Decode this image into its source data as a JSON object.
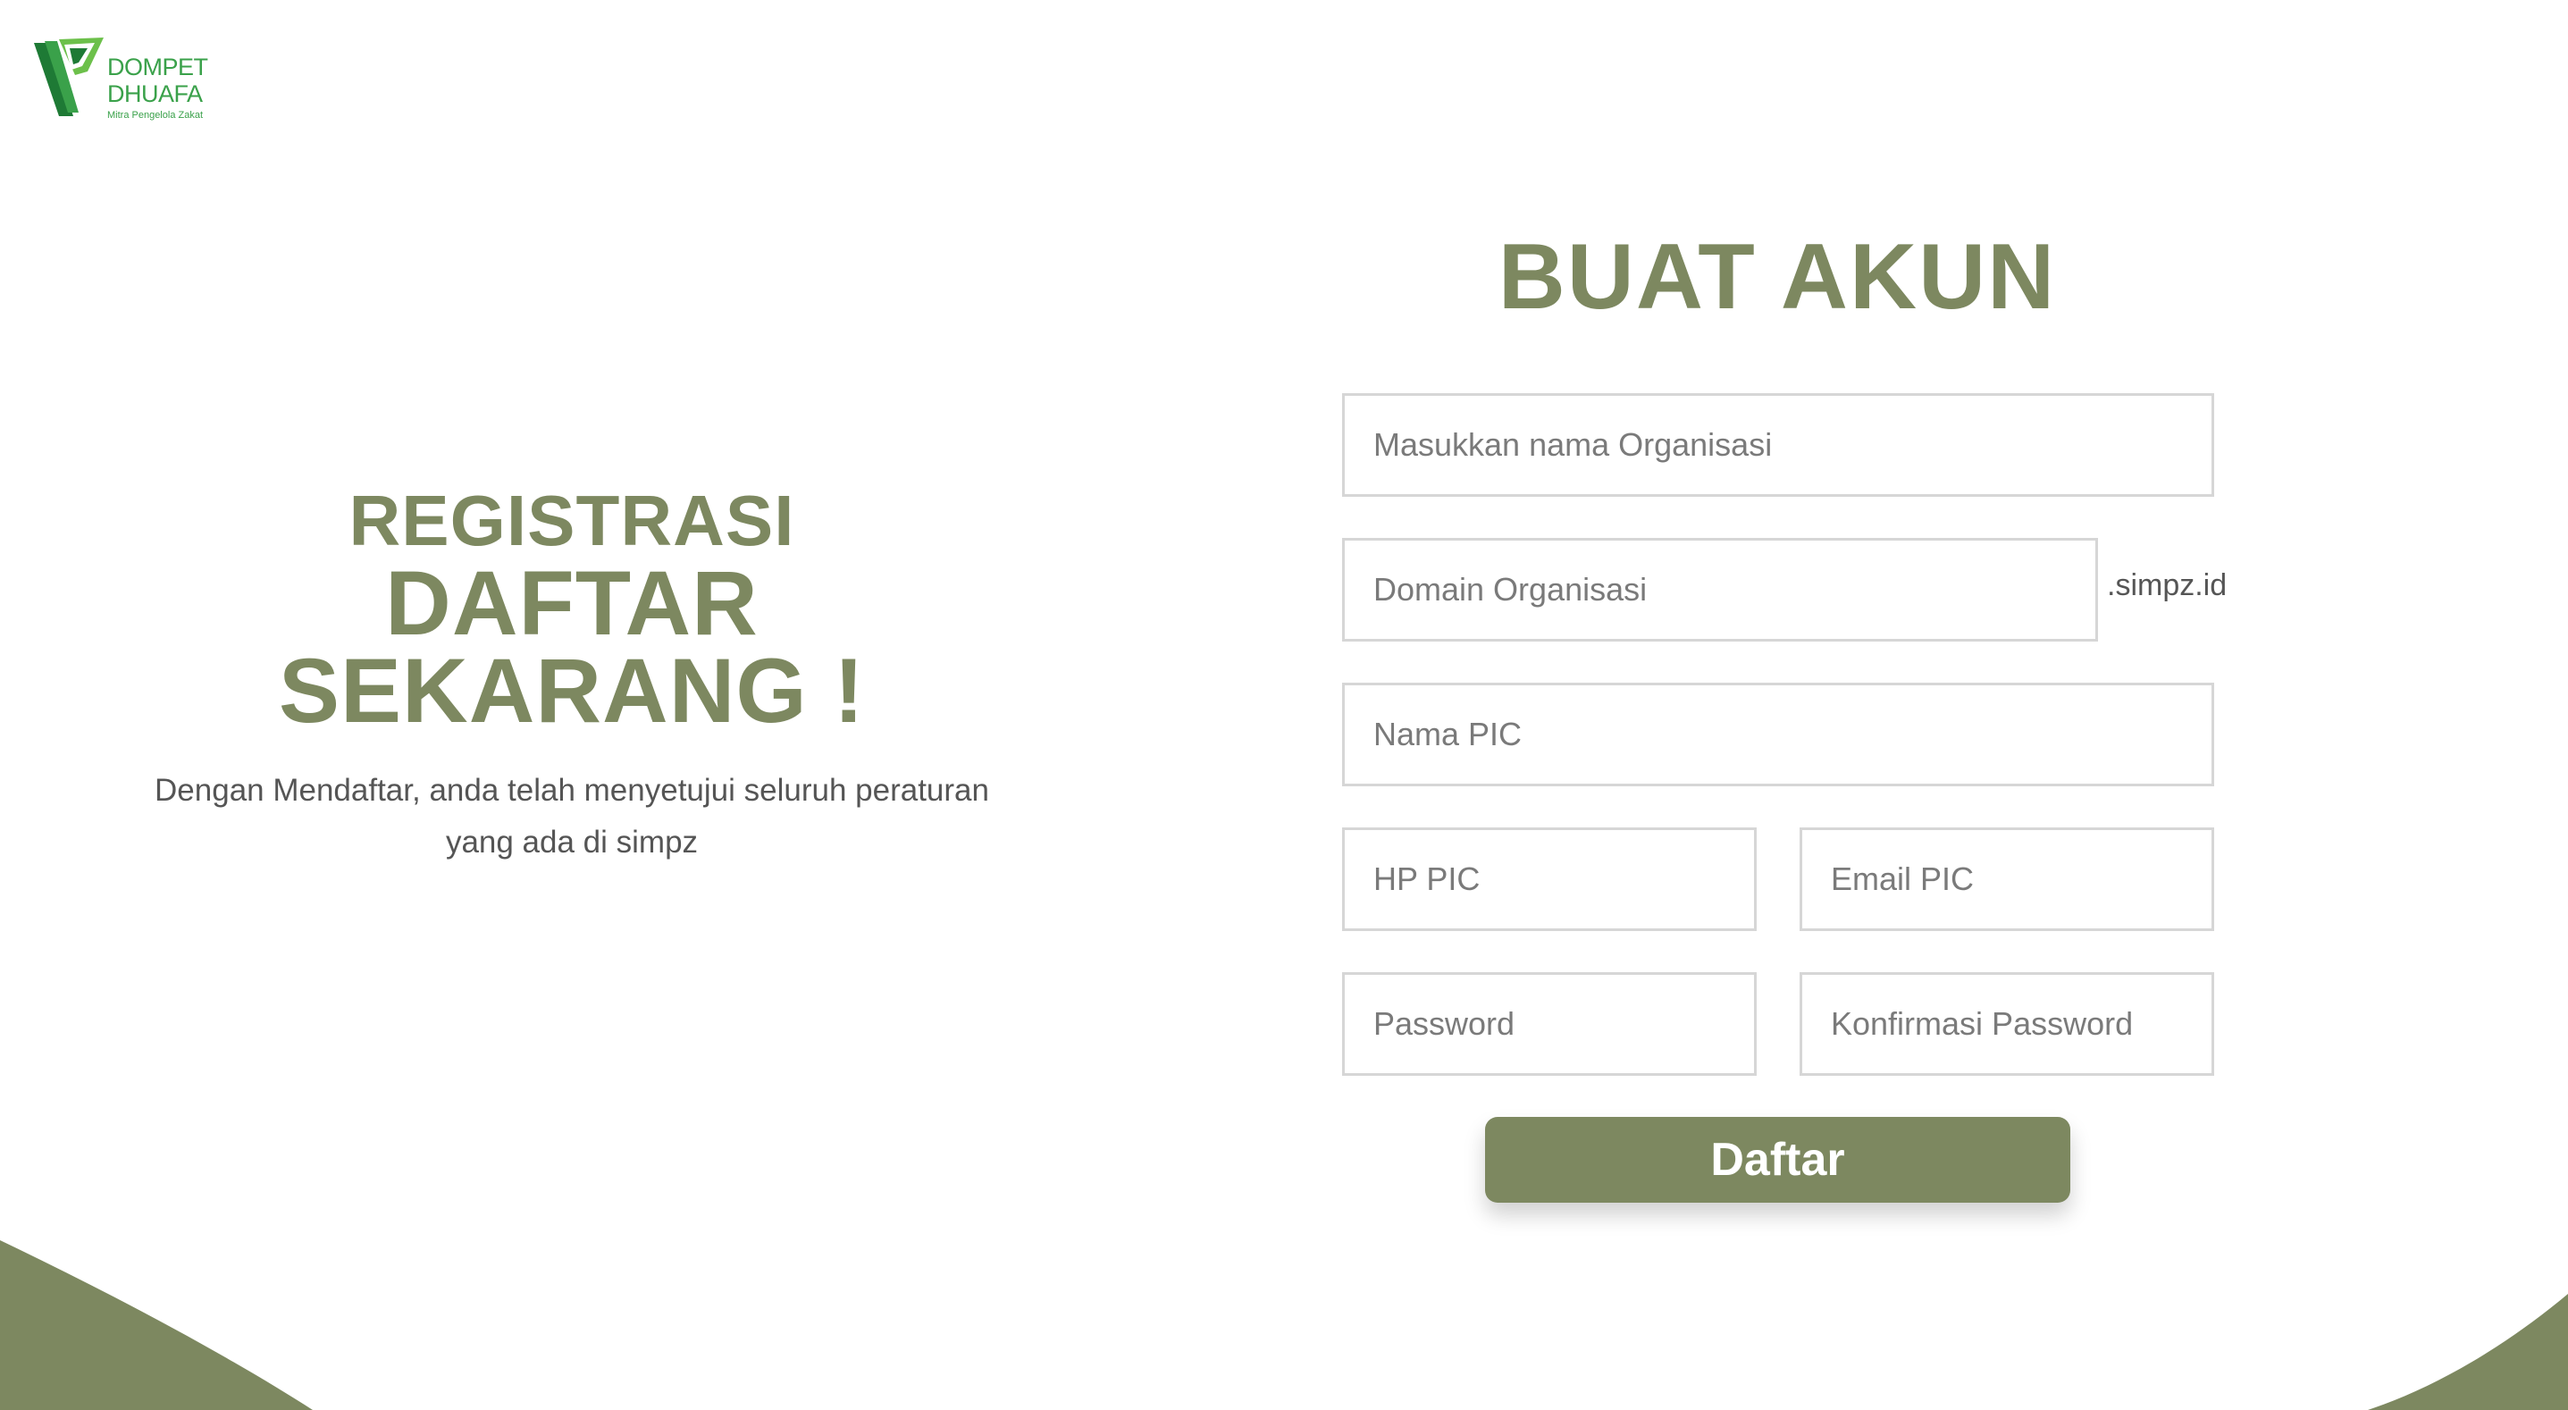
{
  "brand": {
    "line1": "DOMPET",
    "line2": "DHUAFA",
    "tagline": "Mitra Pengelola Zakat",
    "color": "#3aa14a"
  },
  "hero": {
    "title_small": "REGISTRASI",
    "title_large_1": "DAFTAR",
    "title_large_2": "SEKARANG !",
    "desc_line1": "Dengan Mendaftar, anda telah menyetujui seluruh peraturan",
    "desc_line2": "yang ada di simpz"
  },
  "form": {
    "title": "BUAT AKUN",
    "org_name_placeholder": "Masukkan nama Organisasi",
    "domain_placeholder": "Domain Organisasi",
    "domain_suffix": ".simpz.id",
    "pic_name_placeholder": "Nama PIC",
    "pic_phone_placeholder": "HP PIC",
    "pic_email_placeholder": "Email PIC",
    "password_placeholder": "Password",
    "confirm_password_placeholder": "Konfirmasi Password",
    "submit_label": "Daftar"
  },
  "colors": {
    "accent": "#7d8860",
    "text_muted": "#555555",
    "border": "#d6d6d6"
  }
}
